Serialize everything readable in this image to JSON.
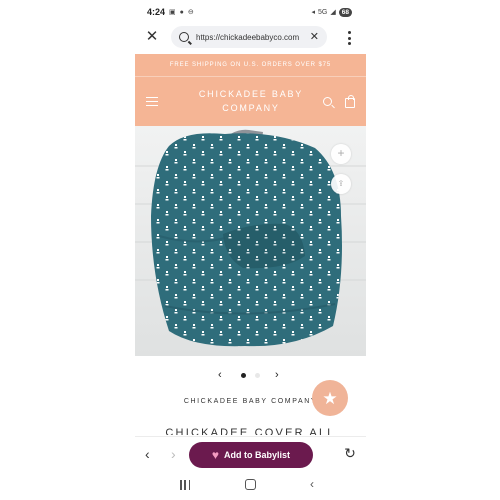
{
  "status_bar": {
    "time": "4:24",
    "left_icons": [
      "screenshot-icon",
      "message-icon",
      "dnd-icon"
    ],
    "network": "5G",
    "battery": "68"
  },
  "browser": {
    "url": "https://chickadeebabyco.com"
  },
  "store": {
    "shipping_banner": "FREE SHIPPING ON U.S. ORDERS OVER $75",
    "brand_line1": "CHICKADEE BABY",
    "brand_line2": "COMPANY"
  },
  "product": {
    "image_colors": {
      "fabric": "#2f6d7b",
      "pattern": "#ffffff",
      "background": "#e9eaea",
      "handle": "#8f9399"
    },
    "carousel": {
      "current_index": 1,
      "total": 2
    },
    "vendor": "CHICKADEE BABY COMPANY",
    "title": "CHICKADEE COVER ALL"
  },
  "toolbar": {
    "babylist_label": "Add to Babylist"
  },
  "colors": {
    "header_bg": "#f5b595",
    "babylist_btn": "#6b1a4e",
    "rewards_btn": "#f0b498"
  }
}
